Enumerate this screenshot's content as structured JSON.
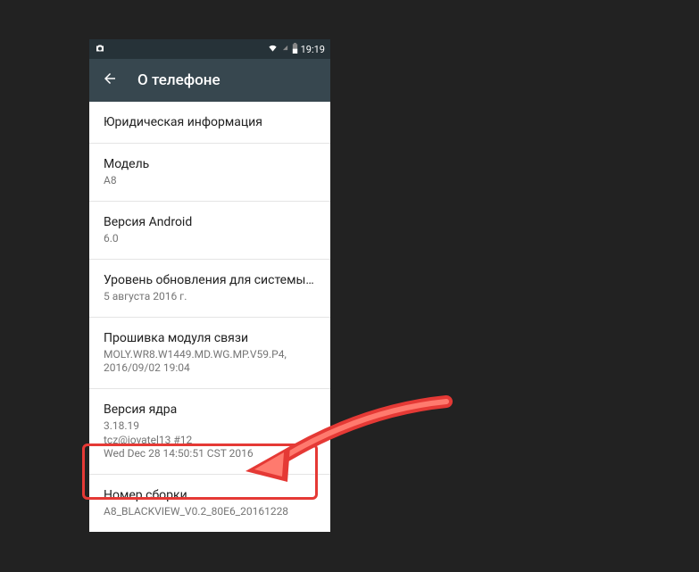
{
  "status_bar": {
    "time": "19:19"
  },
  "app_bar": {
    "title": "О телефоне"
  },
  "items": [
    {
      "title": "Юридическая информация",
      "subtitle": ""
    },
    {
      "title": "Модель",
      "subtitle": "A8"
    },
    {
      "title": "Версия Android",
      "subtitle": "6.0"
    },
    {
      "title": "Уровень обновления для системы безопа…",
      "subtitle": "5 августа 2016 г."
    },
    {
      "title": "Прошивка модуля связи",
      "subtitle": "MOLY.WR8.W1449.MD.WG.MP.V59.P4, 2016/09/02 19:04"
    },
    {
      "title": "Версия ядра",
      "subtitle": "3.18.19\ntcz@joyatel13 #12\nWed Dec 28 14:50:51 CST 2016"
    },
    {
      "title": "Номер сборки",
      "subtitle": "A8_BLACKVIEW_V0.2_80E6_20161228"
    }
  ]
}
